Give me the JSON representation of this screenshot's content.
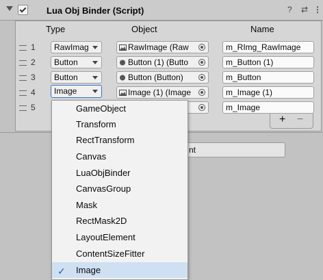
{
  "header": {
    "title": "Lua Obj Binder (Script)",
    "script_icon": "#"
  },
  "columns": {
    "type": "Type",
    "object": "Object",
    "name": "Name"
  },
  "rows": [
    {
      "index": "1",
      "type": "RawImag",
      "object": "RawImage (Raw",
      "name": "m_RImg_RawImage",
      "object_icon": "image-icon"
    },
    {
      "index": "2",
      "type": "Button",
      "object": "Button (1) (Butto",
      "name": "m_Button (1)",
      "object_icon": "gameobject-icon"
    },
    {
      "index": "3",
      "type": "Button",
      "object": "Button (Button)",
      "name": "m_Button",
      "object_icon": "gameobject-icon"
    },
    {
      "index": "4",
      "type": "Image",
      "object": "Image (1) (Image",
      "name": "m_Image (1)",
      "object_icon": "image-icon"
    },
    {
      "index": "5",
      "type": "",
      "object": "",
      "name": "m_Image",
      "object_icon": ""
    }
  ],
  "list_controls": {
    "add": "+",
    "remove": "−"
  },
  "bottom_button_partial": "nt",
  "menu": {
    "items": [
      "GameObject",
      "Transform",
      "RectTransform",
      "Canvas",
      "LuaObjBinder",
      "CanvasGroup",
      "Mask",
      "RectMask2D",
      "LayoutElement",
      "ContentSizeFitter",
      "Image"
    ],
    "selected": "Image"
  },
  "colors": {
    "selection": "#cfe0f3",
    "focus": "#3a72c7",
    "check": "#2b5fa5"
  }
}
